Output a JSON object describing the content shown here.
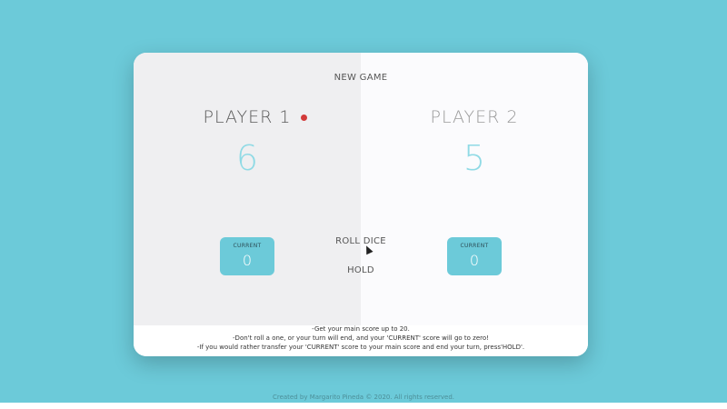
{
  "game": {
    "new_game_label": "NEW GAME",
    "roll_dice_label": "ROLL DICE",
    "hold_label": "HOLD",
    "active_player": 1
  },
  "players": [
    {
      "name": "PLAYER 1",
      "score": "6",
      "current_label": "CURRENT",
      "current_value": "0"
    },
    {
      "name": "PLAYER 2",
      "score": "5",
      "current_label": "CURRENT",
      "current_value": "0"
    }
  ],
  "rules": [
    "-Get your main score up to 20.",
    "-Don't roll a one, or your turn will end, and your 'CURRENT' score will go to zero!",
    "-If you would rather transfer your 'CURRENT' score to your main score and end your turn, press'HOLD'."
  ],
  "footer": {
    "credits": "Created by Margarito Pineda © 2020. All rights reserved."
  },
  "colors": {
    "background": "#6ccad9",
    "active_dot": "#d23a3a",
    "score": "#8fdae5"
  }
}
